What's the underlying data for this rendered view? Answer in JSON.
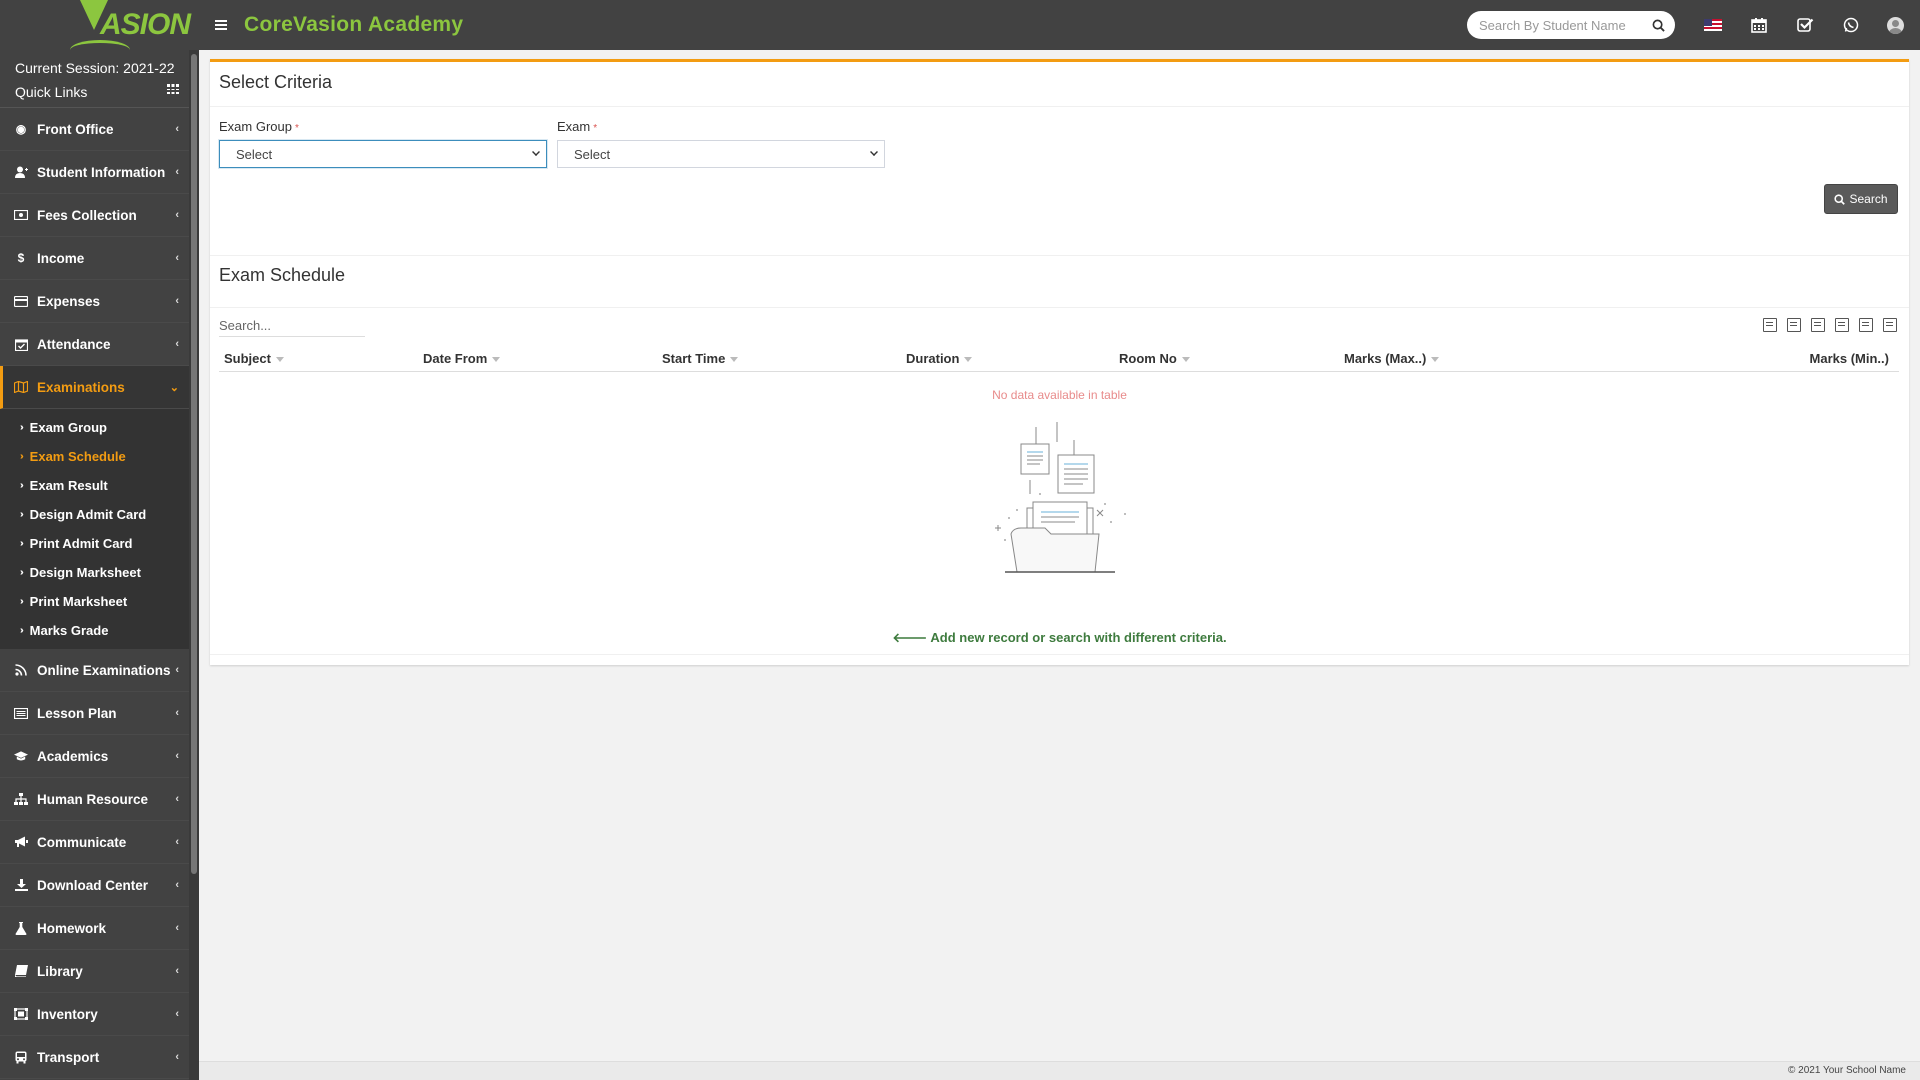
{
  "app": {
    "logo_text": "ASION",
    "title": "CoreVasion Academy"
  },
  "header": {
    "search_placeholder": "Search By Student Name",
    "icons": [
      "search-icon",
      "us-flag-icon",
      "calendar-icon",
      "check-square-icon",
      "whatsapp-icon",
      "user-avatar-icon"
    ]
  },
  "sidebar": {
    "session": "Current Session: 2021-22",
    "quick_links": "Quick Links",
    "items_top": [
      {
        "label": "Front Office",
        "icon": "eye-icon"
      },
      {
        "label": "Student Information",
        "icon": "user-plus-icon"
      },
      {
        "label": "Fees Collection",
        "icon": "money-icon"
      },
      {
        "label": "Income",
        "icon": "dollar-icon"
      },
      {
        "label": "Expenses",
        "icon": "credit-card-icon"
      },
      {
        "label": "Attendance",
        "icon": "calendar-check-icon"
      }
    ],
    "active": {
      "label": "Examinations",
      "icon": "map-icon"
    },
    "submenu": [
      {
        "label": "Exam Group"
      },
      {
        "label": "Exam Schedule",
        "active": true
      },
      {
        "label": "Exam Result"
      },
      {
        "label": "Design Admit Card"
      },
      {
        "label": "Print Admit Card"
      },
      {
        "label": "Design Marksheet"
      },
      {
        "label": "Print Marksheet"
      },
      {
        "label": "Marks Grade"
      }
    ],
    "items_bottom": [
      {
        "label": "Online Examinations",
        "icon": "rss-icon"
      },
      {
        "label": "Lesson Plan",
        "icon": "list-alt-icon"
      },
      {
        "label": "Academics",
        "icon": "mortar-board-icon"
      },
      {
        "label": "Human Resource",
        "icon": "sitemap-icon"
      },
      {
        "label": "Communicate",
        "icon": "bullhorn-icon"
      },
      {
        "label": "Download Center",
        "icon": "download-icon"
      },
      {
        "label": "Homework",
        "icon": "flask-icon"
      },
      {
        "label": "Library",
        "icon": "book-icon"
      },
      {
        "label": "Inventory",
        "icon": "object-group-icon"
      },
      {
        "label": "Transport",
        "icon": "bus-icon"
      }
    ]
  },
  "criteria": {
    "title": "Select Criteria",
    "exam_group_label": "Exam Group",
    "exam_group_value": "Select",
    "exam_label": "Exam",
    "exam_value": "Select",
    "required_mark": "*",
    "search_button": "Search"
  },
  "schedule": {
    "title": "Exam Schedule",
    "search_placeholder": "Search...",
    "columns": [
      "Subject",
      "Date From",
      "Start Time",
      "Duration",
      "Room No",
      "Marks (Max..)",
      "Marks (Min..)"
    ],
    "empty_text": "No data available in table",
    "hint": "Add new record or search with different criteria.",
    "tools": [
      "copy-icon",
      "excel-icon",
      "csv-icon",
      "pdf-icon",
      "print-icon",
      "columns-icon"
    ]
  },
  "footer": {
    "text": "© 2021 Your School Name"
  },
  "colors": {
    "accent": "#f39c12",
    "brand_green": "#8cc63f",
    "dark": "#424242",
    "hint_green": "#3e7b3e",
    "empty_red": "#e88b8b"
  }
}
